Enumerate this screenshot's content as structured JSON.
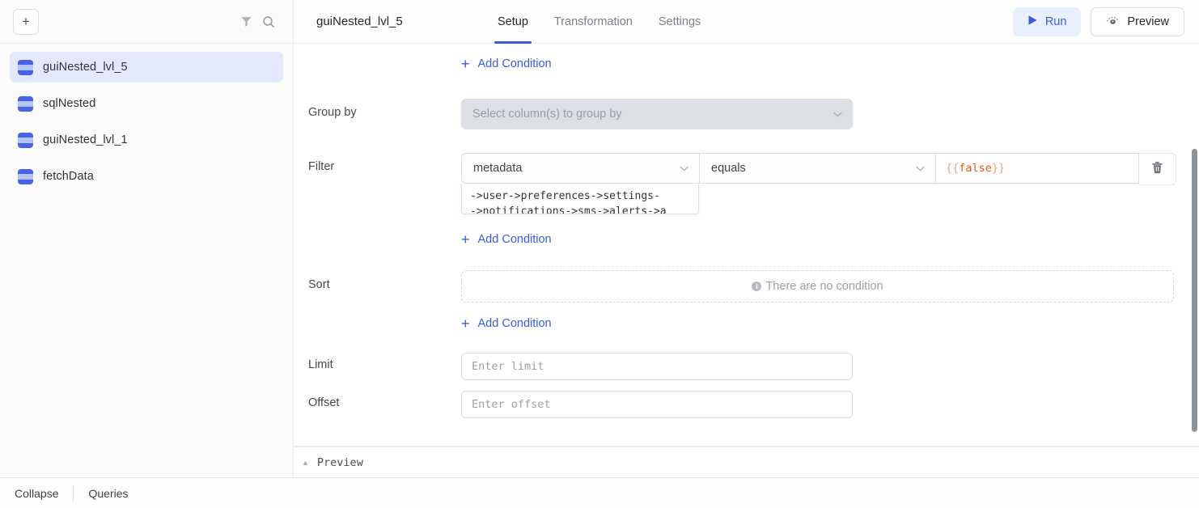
{
  "sidebar": {
    "add_button_label": "+",
    "filter_icon": "filter-icon",
    "search_icon": "search-icon",
    "items": [
      {
        "label": "guiNested_lvl_5",
        "selected": true
      },
      {
        "label": "sqlNested",
        "selected": false
      },
      {
        "label": "guiNested_lvl_1",
        "selected": false
      },
      {
        "label": "fetchData",
        "selected": false
      }
    ]
  },
  "header": {
    "title": "guiNested_lvl_5",
    "tabs": [
      {
        "label": "Setup",
        "active": true
      },
      {
        "label": "Transformation",
        "active": false
      },
      {
        "label": "Settings",
        "active": false
      }
    ],
    "run_label": "Run",
    "preview_label": "Preview",
    "run_icon": "play-icon",
    "preview_icon": "eye-icon",
    "accent_color": "#3b5bdb",
    "run_bg_color": "#eaeffd"
  },
  "form": {
    "top_add_condition": "Add Condition",
    "group_by": {
      "label": "Group by",
      "placeholder": "Select column(s) to group by",
      "disabled": true
    },
    "filter": {
      "label": "Filter",
      "column_value": "metadata",
      "operator_value": "equals",
      "value_open": "{{",
      "value_token": "false",
      "value_close": "}}",
      "dropdown_line1": "->user->preferences->settings-",
      "dropdown_line2": "->notifications->sms->alerts->a",
      "delete_icon": "trash-icon",
      "add_condition": "Add Condition"
    },
    "sort": {
      "label": "Sort",
      "empty_message": "There are no condition",
      "info_icon": "info-icon",
      "add_condition": "Add Condition"
    },
    "limit": {
      "label": "Limit",
      "placeholder": "Enter limit",
      "value": ""
    },
    "offset": {
      "label": "Offset",
      "placeholder": "Enter offset",
      "value": ""
    }
  },
  "preview_strip": {
    "label": "Preview",
    "caret_icon": "caret-up-icon"
  },
  "bottombar": {
    "collapse_label": "Collapse",
    "queries_label": "Queries"
  }
}
